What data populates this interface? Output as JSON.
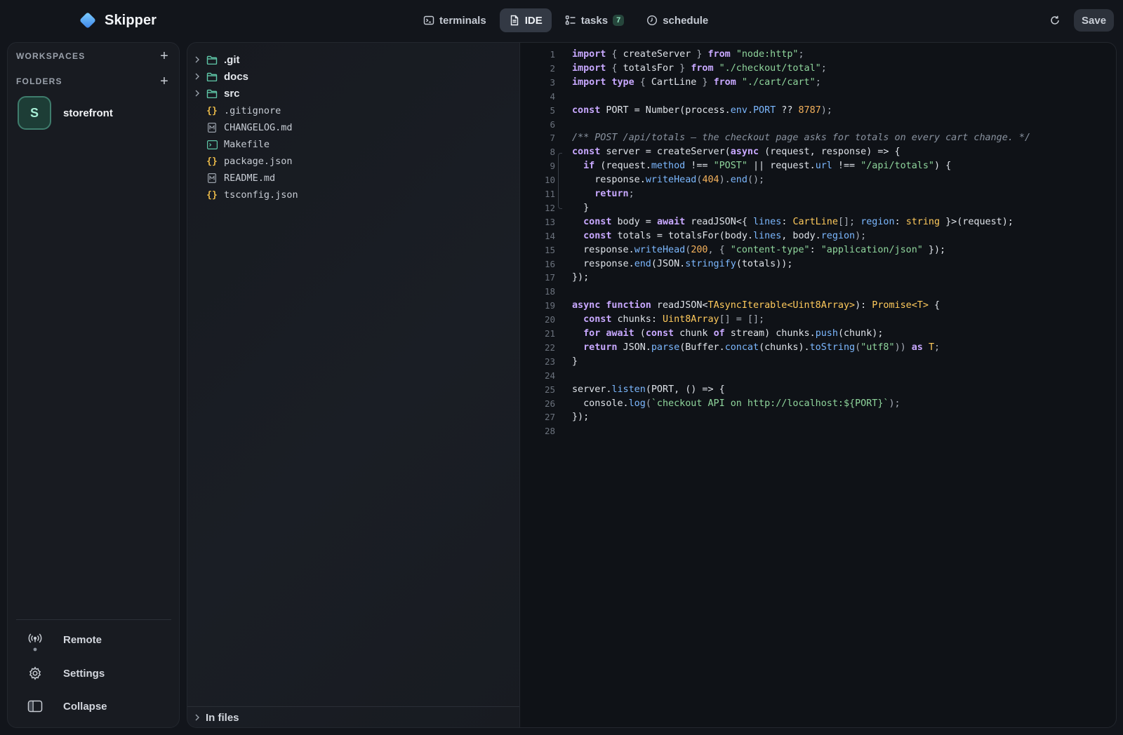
{
  "app": {
    "name": "Skipper"
  },
  "topbar": {
    "tabs": [
      {
        "label": "terminals",
        "icon": "terminal-icon",
        "active": false
      },
      {
        "label": "IDE",
        "icon": "file-icon",
        "active": true
      },
      {
        "label": "tasks",
        "icon": "list-icon",
        "count": "7",
        "active": false
      },
      {
        "label": "schedule",
        "icon": "clock-icon",
        "active": false
      }
    ],
    "save_label": "Save",
    "refresh_icon": "refresh-icon"
  },
  "sidebar": {
    "workspaces_title": "WORKSPACES",
    "folders_title": "FOLDERS",
    "folders": [
      {
        "initial": "S",
        "name": "storefront"
      }
    ],
    "actions": [
      {
        "label": "Remote",
        "icon": "antenna-icon"
      },
      {
        "label": "Settings",
        "icon": "gear-icon"
      },
      {
        "label": "Collapse",
        "icon": "sidebar-panel-icon"
      }
    ]
  },
  "filetree": {
    "dirs": [
      {
        "name": ".git"
      },
      {
        "name": "docs"
      },
      {
        "name": "src"
      }
    ],
    "files": [
      {
        "name": ".gitignore",
        "icon": "braces-icon"
      },
      {
        "name": "CHANGELOG.md",
        "icon": "markdown-icon"
      },
      {
        "name": "Makefile",
        "icon": "terminal-file-icon"
      },
      {
        "name": "package.json",
        "icon": "braces-icon"
      },
      {
        "name": "README.md",
        "icon": "markdown-icon"
      },
      {
        "name": "tsconfig.json",
        "icon": "braces-icon"
      }
    ],
    "infiles_label": "In files"
  },
  "editor": {
    "lines": [
      [
        [
          "kw",
          "import"
        ],
        [
          "pun",
          " { "
        ],
        [
          "",
          "createServer"
        ],
        [
          "pun",
          " } "
        ],
        [
          "kw",
          "from"
        ],
        [
          "",
          " "
        ],
        [
          "str",
          "\"node:http\""
        ],
        [
          "pun",
          ";"
        ]
      ],
      [
        [
          "kw",
          "import"
        ],
        [
          "pun",
          " { "
        ],
        [
          "",
          "totalsFor"
        ],
        [
          "pun",
          " } "
        ],
        [
          "kw",
          "from"
        ],
        [
          "",
          " "
        ],
        [
          "str",
          "\"./checkout/total\""
        ],
        [
          "pun",
          ";"
        ]
      ],
      [
        [
          "kw",
          "import"
        ],
        [
          "",
          " "
        ],
        [
          "kw",
          "type"
        ],
        [
          "pun",
          " { "
        ],
        [
          "",
          "CartLine"
        ],
        [
          "pun",
          " } "
        ],
        [
          "kw",
          "from"
        ],
        [
          "",
          " "
        ],
        [
          "str",
          "\"./cart/cart\""
        ],
        [
          "pun",
          ";"
        ]
      ],
      [],
      [
        [
          "kw",
          "const"
        ],
        [
          "",
          " PORT = Number(process."
        ],
        [
          "prop",
          "env"
        ],
        [
          "pun",
          "."
        ],
        [
          "prop",
          "PORT"
        ],
        [
          "",
          " ?? "
        ],
        [
          "num",
          "8787"
        ],
        [
          "pun",
          ");"
        ]
      ],
      [],
      [
        [
          "cmt",
          "/** POST /api/totals — the checkout page asks for totals on every cart change. */"
        ]
      ],
      [
        [
          "kw",
          "const"
        ],
        [
          "",
          " server = createServer("
        ],
        [
          "kw",
          "async"
        ],
        [
          "",
          " (request, response) => {"
        ]
      ],
      [
        [
          "",
          "  "
        ],
        [
          "kw",
          "if"
        ],
        [
          "",
          " (request."
        ],
        [
          "prop",
          "method"
        ],
        [
          "",
          " !== "
        ],
        [
          "str",
          "\"POST\""
        ],
        [
          "",
          " || request."
        ],
        [
          "prop",
          "url"
        ],
        [
          "",
          " !== "
        ],
        [
          "str",
          "\"/api/totals\""
        ],
        [
          "",
          ") {"
        ]
      ],
      [
        [
          "",
          "    response."
        ],
        [
          "fn",
          "writeHead"
        ],
        [
          "pun",
          "("
        ],
        [
          "num",
          "404"
        ],
        [
          "pun",
          ")."
        ],
        [
          "fn",
          "end"
        ],
        [
          "pun",
          "();"
        ]
      ],
      [
        [
          "",
          "    "
        ],
        [
          "kw",
          "return"
        ],
        [
          "pun",
          ";"
        ]
      ],
      [
        [
          "",
          "  }"
        ]
      ],
      [
        [
          "",
          "  "
        ],
        [
          "kw",
          "const"
        ],
        [
          "",
          " body = "
        ],
        [
          "kw",
          "await"
        ],
        [
          "",
          " readJSON<{ "
        ],
        [
          "prop",
          "lines"
        ],
        [
          "",
          ": "
        ],
        [
          "typ",
          "CartLine"
        ],
        [
          "pun",
          "[]; "
        ],
        [
          "prop",
          "region"
        ],
        [
          "",
          ": "
        ],
        [
          "typ",
          "string"
        ],
        [
          "",
          " }>(request);"
        ]
      ],
      [
        [
          "",
          "  "
        ],
        [
          "kw",
          "const"
        ],
        [
          "",
          " totals = totalsFor(body."
        ],
        [
          "prop",
          "lines"
        ],
        [
          "",
          ", body."
        ],
        [
          "prop",
          "region"
        ],
        [
          "pun",
          ");"
        ]
      ],
      [
        [
          "",
          "  response."
        ],
        [
          "fn",
          "writeHead"
        ],
        [
          "pun",
          "("
        ],
        [
          "num",
          "200"
        ],
        [
          "pun",
          ", { "
        ],
        [
          "str",
          "\"content-type\""
        ],
        [
          "",
          ": "
        ],
        [
          "str",
          "\"application/json\""
        ],
        [
          "",
          " });"
        ]
      ],
      [
        [
          "",
          "  response."
        ],
        [
          "fn",
          "end"
        ],
        [
          "",
          "(JSON."
        ],
        [
          "fn",
          "stringify"
        ],
        [
          "",
          "(totals));"
        ]
      ],
      [
        [
          "",
          "});"
        ]
      ],
      [],
      [
        [
          "kw",
          "async function"
        ],
        [
          "",
          " readJSON<"
        ],
        [
          "typ",
          "T"
        ],
        [
          ">(stream: "
        ],
        [
          "typ",
          "AsyncIterable<Uint8Array>"
        ],
        [
          "",
          "): "
        ],
        [
          "typ",
          "Promise<T>"
        ],
        [
          "",
          " {"
        ]
      ],
      [
        [
          "",
          "  "
        ],
        [
          "kw",
          "const"
        ],
        [
          "",
          " chunks: "
        ],
        [
          "typ",
          "Uint8Array"
        ],
        [
          "pun",
          "[] = [];"
        ]
      ],
      [
        [
          "",
          "  "
        ],
        [
          "kw",
          "for await"
        ],
        [
          "",
          " ("
        ],
        [
          "kw",
          "const"
        ],
        [
          "",
          " chunk "
        ],
        [
          "kw",
          "of"
        ],
        [
          "",
          " stream) chunks."
        ],
        [
          "fn",
          "push"
        ],
        [
          "",
          "(chunk);"
        ]
      ],
      [
        [
          "",
          "  "
        ],
        [
          "kw",
          "return"
        ],
        [
          "",
          " JSON."
        ],
        [
          "fn",
          "parse"
        ],
        [
          "",
          "(Buffer."
        ],
        [
          "fn",
          "concat"
        ],
        [
          "",
          "(chunks)."
        ],
        [
          "fn",
          "toString"
        ],
        [
          "pun",
          "("
        ],
        [
          "str",
          "\"utf8\""
        ],
        [
          "pun",
          "))"
        ],
        [
          "",
          " "
        ],
        [
          "kw",
          "as"
        ],
        [
          "",
          " "
        ],
        [
          "typ",
          "T"
        ],
        [
          "pun",
          ";"
        ]
      ],
      [
        [
          "",
          "}"
        ]
      ],
      [],
      [
        [
          "",
          "server."
        ],
        [
          "fn",
          "listen"
        ],
        [
          "",
          "(PORT, () => {"
        ]
      ],
      [
        [
          "",
          "  console."
        ],
        [
          "fn",
          "log"
        ],
        [
          "pun",
          "("
        ],
        [
          "str",
          "`checkout API on http://localhost:${PORT}`"
        ],
        [
          "pun",
          ");"
        ]
      ],
      [
        [
          "",
          "});"
        ]
      ],
      []
    ]
  }
}
